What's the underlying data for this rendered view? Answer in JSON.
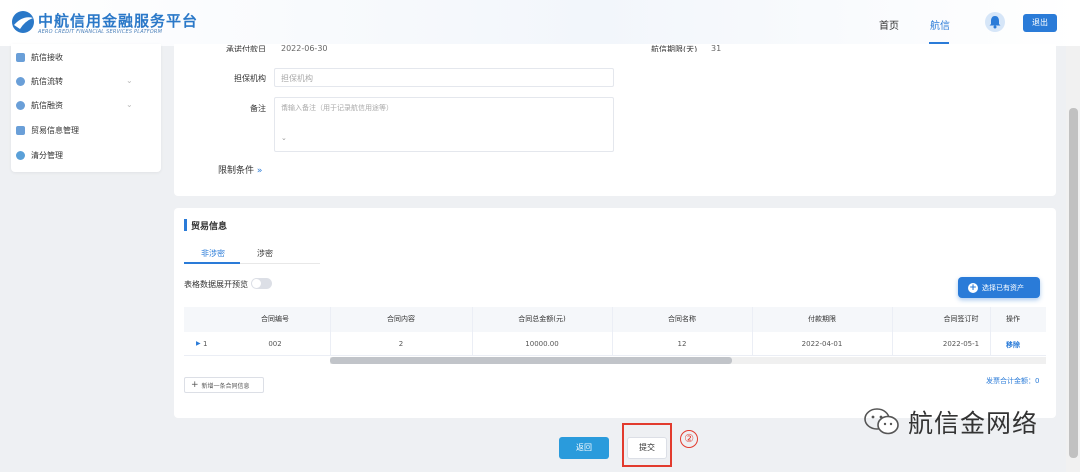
{
  "header": {
    "logo_cn": "中航信用金融服务平台",
    "logo_en": "AERO CREDIT FINANCIAL SERVICES PLATFORM",
    "nav": [
      "首页",
      "航信"
    ],
    "active_nav": "航信",
    "logout_label": "退出"
  },
  "sidebar": {
    "items": [
      {
        "label": "航信接收",
        "icon": "document-icon",
        "has_chevron": false
      },
      {
        "label": "航信流转",
        "icon": "transfer-icon",
        "has_chevron": true
      },
      {
        "label": "航信融资",
        "icon": "finance-icon",
        "has_chevron": true
      },
      {
        "label": "贸易信息管理",
        "icon": "trade-icon",
        "has_chevron": false
      },
      {
        "label": "清分管理",
        "icon": "settle-icon",
        "has_chevron": false
      }
    ]
  },
  "form": {
    "accept_date_label": "承诺付款日",
    "accept_date_value": "2022-06-30",
    "term_label": "航信期限(天)",
    "term_value": "31",
    "guarantor_label": "担保机构",
    "guarantor_placeholder": "担保机构",
    "remark_label": "备注",
    "remark_placeholder": "请输入备注（用于记录航信用途等）",
    "restrict_label": "限制条件"
  },
  "trade": {
    "title": "贸易信息",
    "tabs": [
      "非涉密",
      "涉密"
    ],
    "active_tab": "非涉密",
    "expand_label": "表格数据展开预览",
    "select_asset_label": "选择已有资产",
    "columns": [
      "合同编号",
      "合同内容",
      "合同总金额(元)",
      "合同名称",
      "付款期限",
      "合同签订时",
      "操作"
    ],
    "rows": [
      {
        "index": "1",
        "contract_no": "002",
        "content": "2",
        "amount": "10000.00",
        "name": "12",
        "pay_term": "2022-04-01",
        "sign_date": "2022-05-1",
        "action": "移除"
      }
    ],
    "add_label": "新增一条合同信息",
    "sum_label": "发票合计金额：0"
  },
  "footer": {
    "back_label": "返回",
    "submit_label": "提交",
    "step_marker": "②"
  },
  "watermark": "航信金网络",
  "colors": {
    "primary": "#2a7bd8",
    "highlight": "#e23b2e"
  }
}
